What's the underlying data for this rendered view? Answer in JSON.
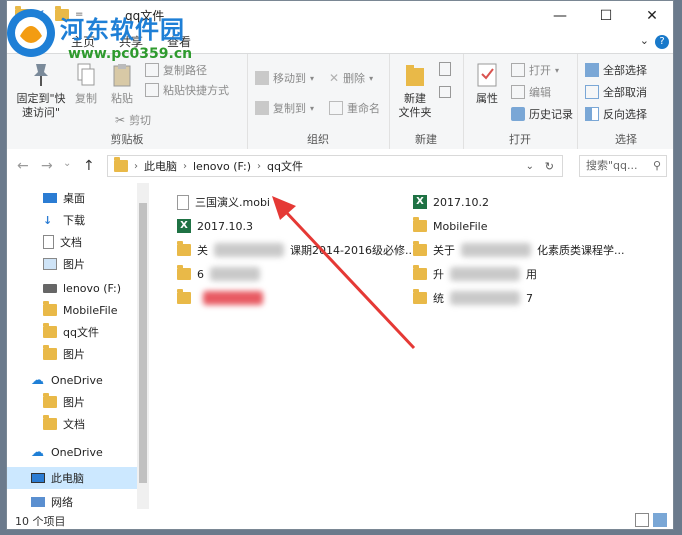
{
  "window": {
    "title": "qq文件"
  },
  "watermark": {
    "site_name": "河东软件园",
    "url": "www.pc0359.cn"
  },
  "tabs": [
    {
      "label": "文件"
    },
    {
      "label": "主页"
    },
    {
      "label": "共享"
    },
    {
      "label": "查看"
    }
  ],
  "ribbon": {
    "clipboard": {
      "group_label": "剪贴板",
      "pin_line1": "固定到\"快",
      "pin_line2": "速访问\"",
      "copy": "复制",
      "paste": "粘贴",
      "copy_path": "复制路径",
      "paste_shortcut": "粘贴快捷方式",
      "cut": "剪切"
    },
    "organize": {
      "group_label": "组织",
      "move_to": "移动到",
      "copy_to": "复制到",
      "delete": "删除",
      "rename": "重命名"
    },
    "new": {
      "group_label": "新建",
      "new_folder_line1": "新建",
      "new_folder_line2": "文件夹"
    },
    "open": {
      "group_label": "打开",
      "properties": "属性",
      "open": "打开",
      "edit": "编辑",
      "history": "历史记录"
    },
    "select": {
      "group_label": "选择",
      "select_all": "全部选择",
      "select_none": "全部取消",
      "invert": "反向选择"
    }
  },
  "address": {
    "crumbs": [
      "此电脑",
      "lenovo (F:)",
      "qq文件"
    ],
    "search_placeholder": "搜索\"qq..."
  },
  "nav": {
    "items": [
      {
        "label": "桌面",
        "icon": "desktop-icon",
        "pinned": true
      },
      {
        "label": "下载",
        "icon": "download-icon",
        "pinned": true
      },
      {
        "label": "文档",
        "icon": "document-icon",
        "pinned": true
      },
      {
        "label": "图片",
        "icon": "picture-icon",
        "pinned": true
      },
      {
        "label": "lenovo (F:)",
        "icon": "drive-icon",
        "pinned": false
      },
      {
        "label": "MobileFile",
        "icon": "folder-icon",
        "pinned": false
      },
      {
        "label": "qq文件",
        "icon": "folder-icon",
        "pinned": false
      },
      {
        "label": "图片",
        "icon": "folder-icon",
        "pinned": false
      },
      {
        "label": "OneDrive",
        "icon": "cloud-icon",
        "pinned": false
      },
      {
        "label": "图片",
        "icon": "folder-icon",
        "pinned": false
      },
      {
        "label": "文档",
        "icon": "folder-icon",
        "pinned": false
      },
      {
        "label": "OneDrive",
        "icon": "cloud-icon",
        "pinned": false
      },
      {
        "label": "此电脑",
        "icon": "computer-icon",
        "pinned": false
      },
      {
        "label": "网络",
        "icon": "network-icon",
        "pinned": false
      }
    ]
  },
  "files": {
    "left": [
      {
        "name": "三国演义.mobi",
        "icon": "file-icon"
      },
      {
        "name": "2017.10.3",
        "icon": "excel-icon"
      },
      {
        "name": "关",
        "icon": "folder-icon",
        "suffix": "课期2014-2016级必修..."
      },
      {
        "name": "6",
        "icon": "folder-icon",
        "suffix": ""
      },
      {
        "name": "",
        "icon": "folder-icon",
        "suffix": ""
      }
    ],
    "right": [
      {
        "name": "2017.10.2",
        "icon": "excel-icon"
      },
      {
        "name": "MobileFile",
        "icon": "folder-icon"
      },
      {
        "name": "关于",
        "icon": "folder-icon",
        "suffix": "化素质类课程学..."
      },
      {
        "name": "升",
        "icon": "folder-icon",
        "suffix": "用"
      },
      {
        "name": "统",
        "icon": "folder-icon",
        "suffix": "7"
      }
    ]
  },
  "status": {
    "item_count": "10 个项目"
  },
  "colors": {
    "accent": "#1979ca",
    "selection": "#cce8ff",
    "folder": "#e9b948",
    "arrow": "#e53935"
  }
}
